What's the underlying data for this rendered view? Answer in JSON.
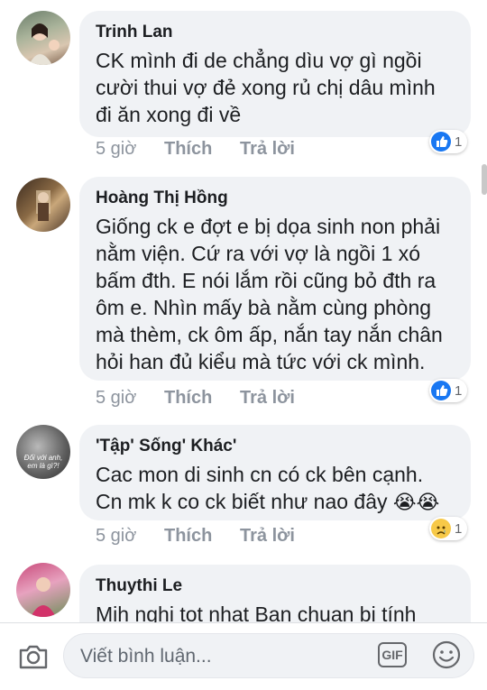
{
  "comments": [
    {
      "author": "Trinh Lan",
      "text": "CK mình đi  de chẳng dìu vợ gì  ngồi\ncười thui vợ đẻ xong rủ chị dâu mình\nđi ăn xong đi về",
      "time": "5 giờ",
      "like": "Thích",
      "reply": "Trả lời",
      "reaction": {
        "icon": "like-icon",
        "count": "1"
      }
    },
    {
      "author": "Hoàng Thị Hồng",
      "text": "Giống ck e đợt e bị dọa sinh non phải\nnằm viện. Cứ ra với vợ là ngồi 1 xó\nbấm đth. E nói lắm rồi cũng bỏ đth ra\nôm e. Nhìn mấy bà nằm cùng phòng\nmà thèm, ck ôm ấp, nắn tay nắn chân\nhỏi han đủ kiểu mà tức với ck mình.",
      "time": "5 giờ",
      "like": "Thích",
      "reply": "Trả lời",
      "reaction": {
        "icon": "like-icon",
        "count": "1"
      }
    },
    {
      "author": "'Tập' Sống' Khác'",
      "text": "Cac mon di sinh cn có ck bên cạnh.\nCn mk k co ck biết như nao đây",
      "emoji": "😭😭",
      "avatar_caption": "Đối với anh,\nem là gì?!",
      "time": "5 giờ",
      "like": "Thích",
      "reply": "Trả lời",
      "reaction": {
        "icon": "sad-icon",
        "count": "1"
      }
    },
    {
      "author": "Thuythi Le",
      "text": "Mih nghi tot nhat Ban chuan bi tính"
    }
  ],
  "composer": {
    "placeholder": "Viết bình luận...",
    "gif_label": "GIF"
  }
}
